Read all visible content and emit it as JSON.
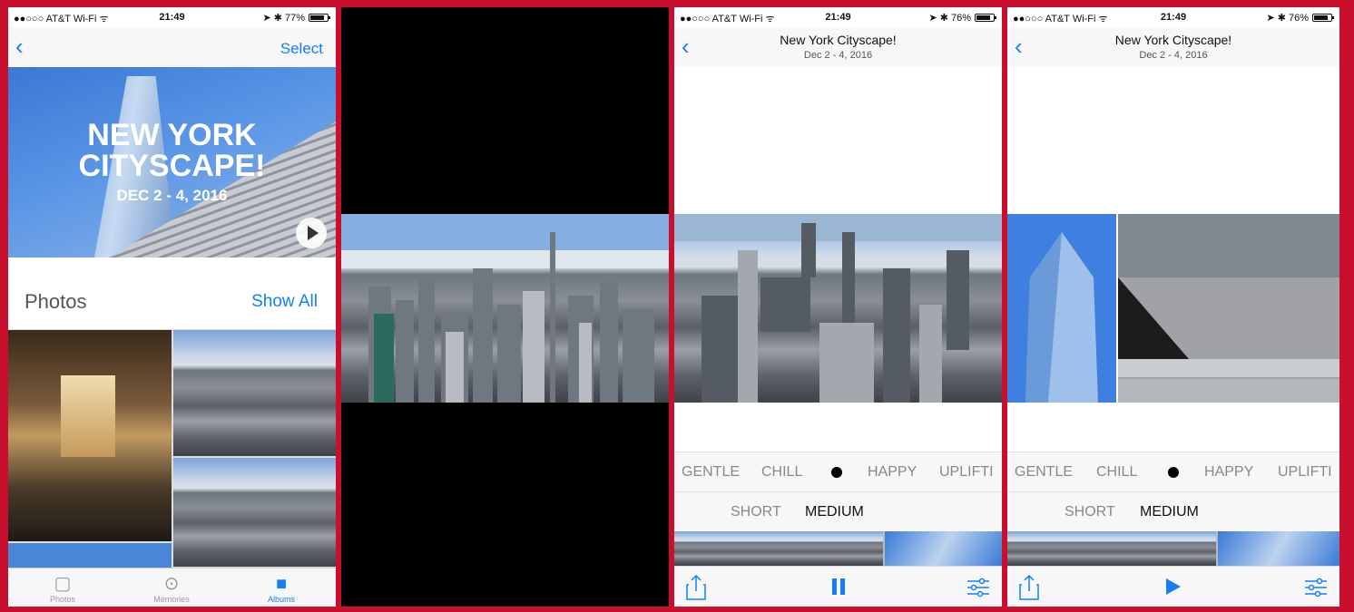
{
  "colors": {
    "frame": "#c8102e",
    "accent": "#147efb",
    "bar": "#f7f7f7"
  },
  "status": {
    "p1": {
      "carrier": "●●○○○ AT&T Wi-Fi ᯤ",
      "time": "21:49",
      "battery": "➤ ✱ 77%"
    },
    "p3": {
      "carrier": "●●○○○ AT&T Wi-Fi ᯤ",
      "time": "21:49",
      "battery": "➤ ✱ 76%"
    },
    "p4": {
      "carrier": "●●○○○ AT&T Wi-Fi ᯤ",
      "time": "21:49",
      "battery": "➤ ✱ 76%"
    }
  },
  "album": {
    "back": "‹",
    "select": "Select",
    "hero_title": "NEW YORK CITYSCAPE!",
    "hero_date": "DEC 2 - 4, 2016",
    "photos_label": "Photos",
    "show_all": "Show All"
  },
  "tabbar": {
    "items": [
      {
        "label": "Photos",
        "icon": "photos-icon"
      },
      {
        "label": "Memories",
        "icon": "memories-icon"
      },
      {
        "label": "Albums",
        "icon": "albums-icon"
      }
    ]
  },
  "memory": {
    "back": "‹",
    "title": "New York Cityscape!",
    "subtitle": "Dec 2 - 4, 2016",
    "moods": [
      "GENTLE",
      "CHILL",
      "HAPPY",
      "UPLIFTI"
    ],
    "lengths": [
      "SHORT",
      "MEDIUM"
    ],
    "selected_length": "MEDIUM"
  },
  "playback": {
    "p3": "paused-state-icon",
    "p4": "play-icon"
  }
}
